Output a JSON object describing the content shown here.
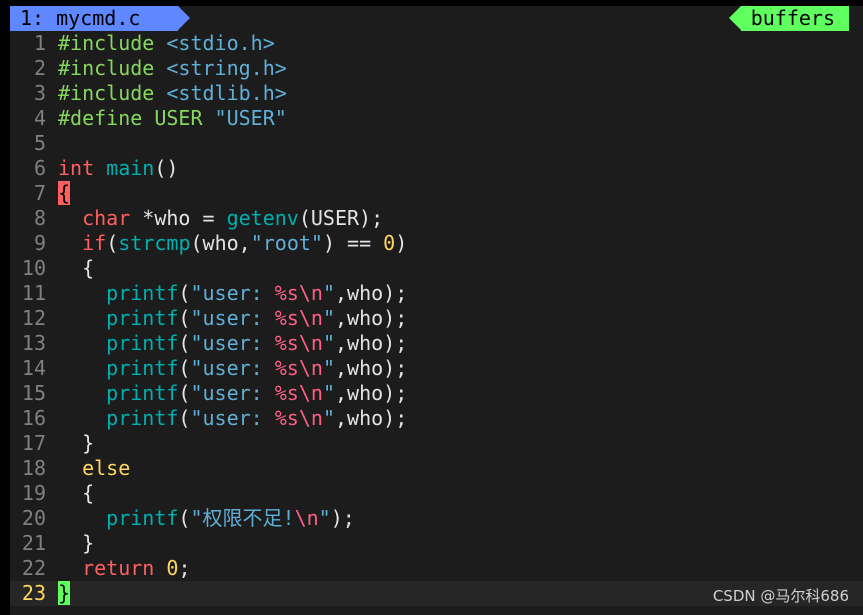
{
  "tabline": {
    "active_tab": "1: mycmd.c",
    "buffers_label": "buffers"
  },
  "lines": [
    {
      "n": "1"
    },
    {
      "n": "2"
    },
    {
      "n": "3"
    },
    {
      "n": "4"
    },
    {
      "n": "5"
    },
    {
      "n": "6"
    },
    {
      "n": "7"
    },
    {
      "n": "8"
    },
    {
      "n": "9"
    },
    {
      "n": "10"
    },
    {
      "n": "11"
    },
    {
      "n": "12"
    },
    {
      "n": "13"
    },
    {
      "n": "14"
    },
    {
      "n": "15"
    },
    {
      "n": "16"
    },
    {
      "n": "17"
    },
    {
      "n": "18"
    },
    {
      "n": "19"
    },
    {
      "n": "20"
    },
    {
      "n": "21"
    },
    {
      "n": "22"
    },
    {
      "n": "23"
    }
  ],
  "code": {
    "l1": {
      "a": "#include",
      "b": "<stdio.h>"
    },
    "l2": {
      "a": "#include",
      "b": "<string.h>"
    },
    "l3": {
      "a": "#include",
      "b": "<stdlib.h>"
    },
    "l4": {
      "a": "#define USER",
      "b": "\"USER\""
    },
    "l6": {
      "a": "int",
      "b": "main",
      "c": "()"
    },
    "l7": {
      "a": "{"
    },
    "l8": {
      "a": "char",
      "b": " *who = ",
      "c": "getenv",
      "d": "(USER);"
    },
    "l9": {
      "a": "if",
      "b": "(",
      "c": "strcmp",
      "d": "(who,",
      "e": "\"root\"",
      "f": ") == ",
      "g": "0",
      "h": ")"
    },
    "l10": {
      "a": "{"
    },
    "printf_line": {
      "fn": "printf",
      "p1": "(",
      "s1": "\"user: ",
      "fmt": "%s\\n",
      "s2": "\"",
      "rest": ",who);"
    },
    "l17": {
      "a": "}"
    },
    "l18": {
      "a": "else"
    },
    "l19": {
      "a": "{"
    },
    "l20": {
      "fn": "printf",
      "p1": "(",
      "s1": "\"权限不足!",
      "fmt": "\\n",
      "s2": "\"",
      "rest": ");"
    },
    "l21": {
      "a": "}"
    },
    "l22": {
      "a": "return",
      "b": " ",
      "c": "0",
      "d": ";"
    },
    "l23": {
      "a": "}"
    }
  },
  "watermark": "CSDN @马尔科686",
  "colors": {
    "tab_active": "#5f87ff",
    "buffers": "#5fff5f",
    "keyword": "#ff5f5f",
    "function": "#00afaf",
    "string": "#5fafd7",
    "preproc": "#87d75f",
    "number": "#ffd75f"
  }
}
